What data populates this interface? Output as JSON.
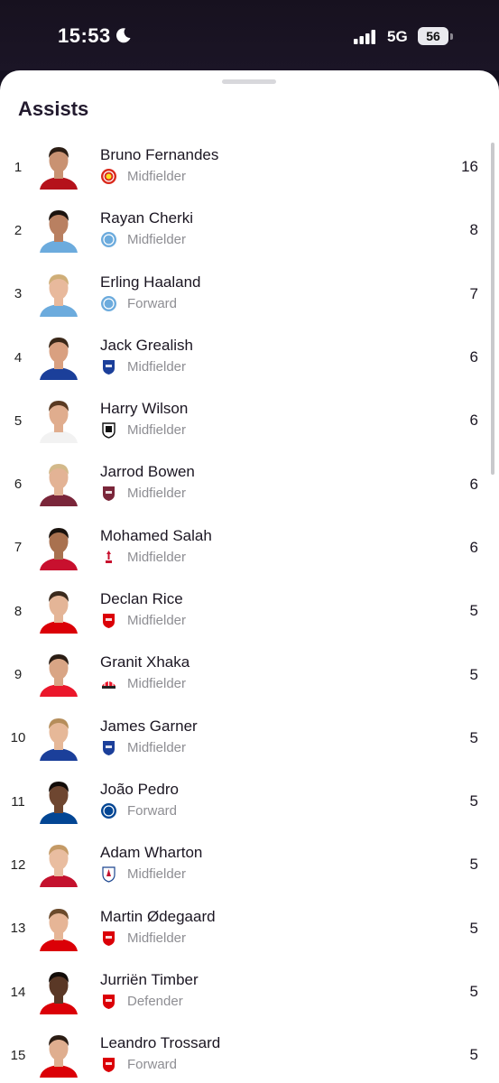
{
  "status_bar": {
    "time": "15:53",
    "network": "5G",
    "battery": "56"
  },
  "sheet": {
    "title": "Assists"
  },
  "players": [
    {
      "rank": "1",
      "name": "Bruno Fernandes",
      "position": "Midfielder",
      "value": "16",
      "club": "manchester-united",
      "club_color": "#da291c",
      "shirt": "#b5121b",
      "skin": "#c99272",
      "hair": "#2b1d14"
    },
    {
      "rank": "2",
      "name": "Rayan Cherki",
      "position": "Midfielder",
      "value": "8",
      "club": "manchester-city",
      "club_color": "#6cabdd",
      "shirt": "#6cabdd",
      "skin": "#b98061",
      "hair": "#1b130f"
    },
    {
      "rank": "3",
      "name": "Erling Haaland",
      "position": "Forward",
      "value": "7",
      "club": "manchester-city",
      "club_color": "#6cabdd",
      "shirt": "#6cabdd",
      "skin": "#e8b99c",
      "hair": "#cfae78"
    },
    {
      "rank": "4",
      "name": "Jack Grealish",
      "position": "Midfielder",
      "value": "6",
      "club": "everton",
      "club_color": "#1b3f9a",
      "shirt": "#1b3f9a",
      "skin": "#d9a080",
      "hair": "#3a2718"
    },
    {
      "rank": "5",
      "name": "Harry Wilson",
      "position": "Midfielder",
      "value": "6",
      "club": "fulham",
      "club_color": "#111111",
      "shirt": "#f2f2f2",
      "skin": "#e0ad8e",
      "hair": "#5a3a22"
    },
    {
      "rank": "6",
      "name": "Jarrod Bowen",
      "position": "Midfielder",
      "value": "6",
      "club": "west-ham",
      "club_color": "#7a263a",
      "shirt": "#7a263a",
      "skin": "#e3b395",
      "hair": "#d3b98a"
    },
    {
      "rank": "7",
      "name": "Mohamed Salah",
      "position": "Midfielder",
      "value": "6",
      "club": "liverpool",
      "club_color": "#c8102e",
      "shirt": "#c8102e",
      "skin": "#a9714f",
      "hair": "#1a120d"
    },
    {
      "rank": "8",
      "name": "Declan Rice",
      "position": "Midfielder",
      "value": "5",
      "club": "arsenal",
      "club_color": "#db0007",
      "shirt": "#db0007",
      "skin": "#e4b597",
      "hair": "#3a2a1d"
    },
    {
      "rank": "9",
      "name": "Granit Xhaka",
      "position": "Midfielder",
      "value": "5",
      "club": "sunderland",
      "club_color": "#eb172b",
      "shirt": "#eb172b",
      "skin": "#d9a585",
      "hair": "#2a1d14"
    },
    {
      "rank": "10",
      "name": "James Garner",
      "position": "Midfielder",
      "value": "5",
      "club": "everton",
      "club_color": "#1b3f9a",
      "shirt": "#1b3f9a",
      "skin": "#e6b898",
      "hair": "#b58d5a"
    },
    {
      "rank": "11",
      "name": "João Pedro",
      "position": "Forward",
      "value": "5",
      "club": "chelsea",
      "club_color": "#034694",
      "shirt": "#034694",
      "skin": "#6e4630",
      "hair": "#120c09"
    },
    {
      "rank": "12",
      "name": "Adam Wharton",
      "position": "Midfielder",
      "value": "5",
      "club": "crystal-palace",
      "club_color": "#1b458f",
      "shirt": "#c4122e",
      "skin": "#e9bda0",
      "hair": "#c49a66"
    },
    {
      "rank": "13",
      "name": "Martin Ødegaard",
      "position": "Midfielder",
      "value": "5",
      "club": "arsenal",
      "club_color": "#db0007",
      "shirt": "#db0007",
      "skin": "#e6b596",
      "hair": "#6b4a2b"
    },
    {
      "rank": "14",
      "name": "Jurriën Timber",
      "position": "Defender",
      "value": "5",
      "club": "arsenal",
      "club_color": "#db0007",
      "shirt": "#db0007",
      "skin": "#5a3826",
      "hair": "#120c09"
    },
    {
      "rank": "15",
      "name": "Leandro Trossard",
      "position": "Forward",
      "value": "5",
      "club": "arsenal",
      "club_color": "#db0007",
      "shirt": "#db0007",
      "skin": "#dfae8f",
      "hair": "#2b1d14"
    }
  ]
}
